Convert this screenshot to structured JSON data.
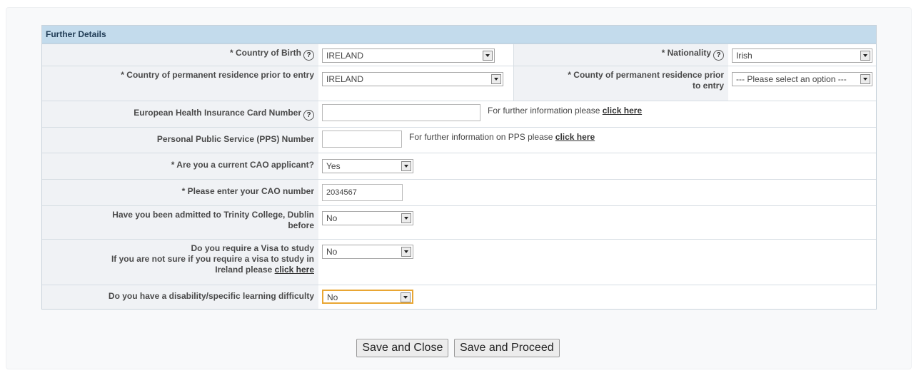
{
  "section_title": "Further Details",
  "country_birth": {
    "label": "* Country of Birth",
    "value": "IRELAND"
  },
  "nationality": {
    "label": "* Nationality",
    "value": "Irish"
  },
  "country_residence": {
    "label": "* Country of permanent residence prior to entry",
    "value": "IRELAND"
  },
  "county_residence": {
    "label_1": "* County of permanent residence prior",
    "label_2": "to entry",
    "value": "--- Please select an option ---"
  },
  "ehic": {
    "label": "European Health Insurance Card Number",
    "value": "",
    "note": "For further information please",
    "link": "click here"
  },
  "pps": {
    "label": "Personal Public Service (PPS) Number",
    "value": "",
    "note": "For further information on PPS please",
    "link": "click here"
  },
  "cao_applicant": {
    "label": "* Are you a current CAO applicant?",
    "value": "Yes"
  },
  "cao_number": {
    "label": "* Please enter your CAO number",
    "value": "2034567"
  },
  "admitted": {
    "label_1": "Have you been admitted to Trinity College, Dublin",
    "label_2": "before",
    "value": "No"
  },
  "visa": {
    "label_1": "Do you require a Visa to study",
    "label_2": "If you are not sure if you require a visa to study in",
    "label_3": "Ireland please",
    "link": "click here",
    "value": "No"
  },
  "disability": {
    "label": "Do you have a disability/specific learning difficulty",
    "value": "No"
  },
  "buttons": {
    "save_close": "Save and Close",
    "save_proceed": "Save and Proceed"
  },
  "colors": {
    "header_bg": "#c3dbec",
    "label_bg": "#f0f2f5",
    "focus_border": "#e9a633"
  }
}
